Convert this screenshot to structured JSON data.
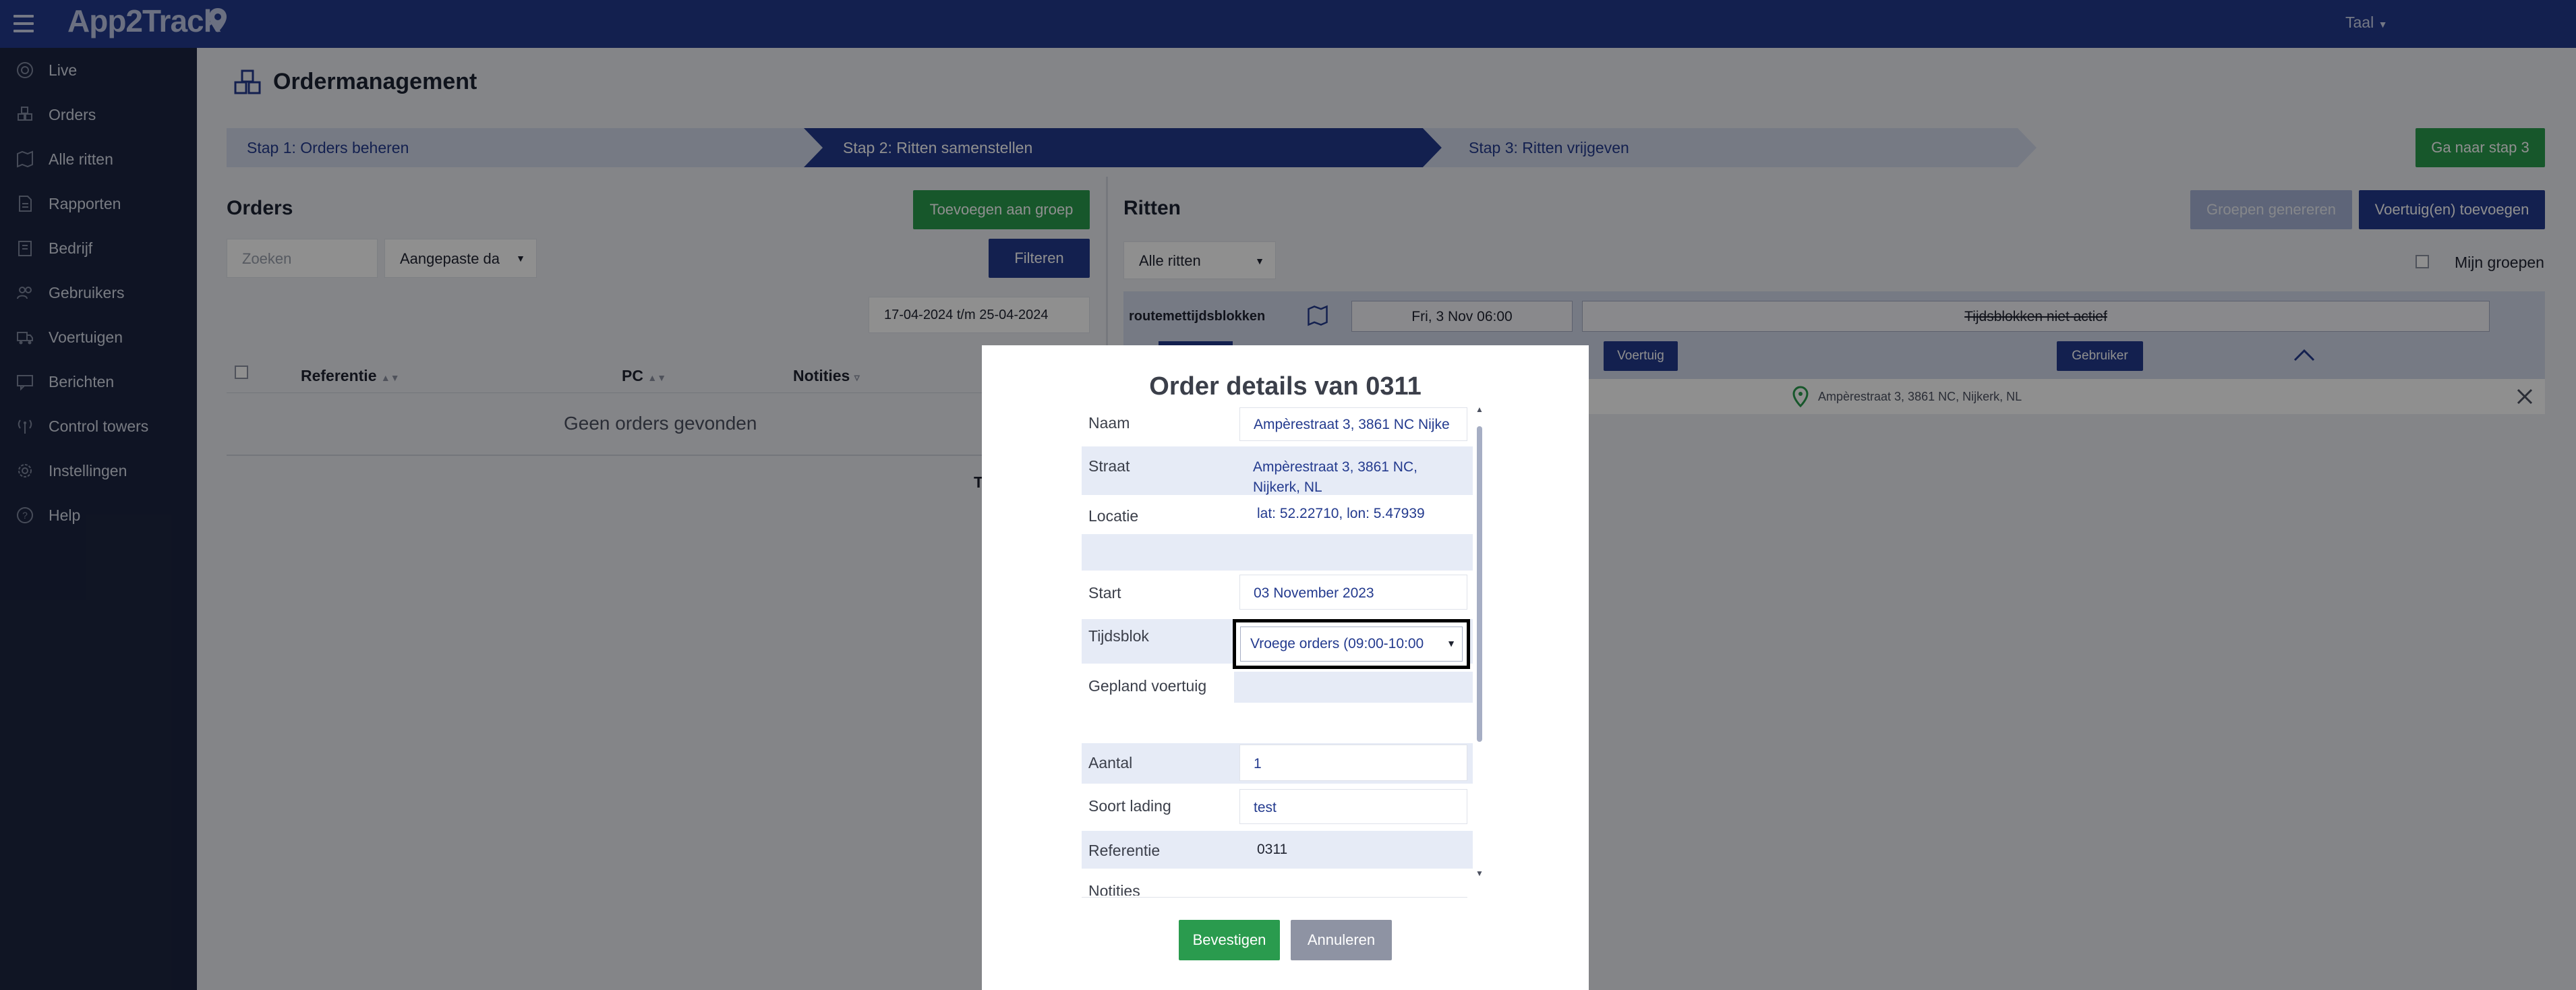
{
  "topbar": {
    "logo": "App2Track",
    "language_label": "Taal"
  },
  "sidebar": {
    "items": [
      {
        "label": "Live",
        "icon": "live-icon"
      },
      {
        "label": "Orders",
        "icon": "orders-icon"
      },
      {
        "label": "Alle ritten",
        "icon": "map-icon"
      },
      {
        "label": "Rapporten",
        "icon": "report-icon"
      },
      {
        "label": "Bedrijf",
        "icon": "building-icon"
      },
      {
        "label": "Gebruikers",
        "icon": "users-icon"
      },
      {
        "label": "Voertuigen",
        "icon": "truck-icon"
      },
      {
        "label": "Berichten",
        "icon": "message-icon"
      },
      {
        "label": "Control towers",
        "icon": "tower-icon"
      },
      {
        "label": "Instellingen",
        "icon": "gear-icon"
      },
      {
        "label": "Help",
        "icon": "help-icon"
      }
    ]
  },
  "page": {
    "title": "Ordermanagement"
  },
  "steps": [
    {
      "label": "Stap 1: Orders beheren",
      "active": false
    },
    {
      "label": "Stap 2: Ritten samenstellen",
      "active": true
    },
    {
      "label": "Stap 3: Ritten vrijgeven",
      "active": false
    }
  ],
  "step_button": "Ga naar stap 3",
  "orders": {
    "title": "Orders",
    "add_group_button": "Toevoegen aan groep",
    "search_placeholder": "Zoeken",
    "custom_select": "Aangepaste da",
    "filter_button": "Filteren",
    "date_range": "17-04-2024 t/m 25-04-2024",
    "columns": [
      "Referentie",
      "PC",
      "Notities"
    ],
    "empty_text": "Geen orders gevonden",
    "footer_letter": "T"
  },
  "ritten": {
    "title": "Ritten",
    "generate_button": "Groepen genereren",
    "add_vehicle_button": "Voertuig(en) toevoegen",
    "filter_select": "Alle ritten",
    "my_groups_label": "Mijn groepen",
    "route_name": "routemettijdsblokken",
    "route_date": "Fri, 3 Nov 06:00",
    "timeblocks_status": "Tijdsblokken niet actief",
    "vehicle_button": "Voertuig",
    "user_button": "Gebruiker",
    "stop_address": "Ampèrestraat 3, 3861 NC, Nijkerk, NL"
  },
  "dialog": {
    "title": "Order details van 0311",
    "fields": {
      "naam": {
        "label": "Naam",
        "value": "Ampèrestraat 3, 3861 NC Nijke"
      },
      "straat": {
        "label": "Straat",
        "line1": "Ampèrestraat 3, 3861 NC,",
        "line2": "Nijkerk, NL"
      },
      "locatie": {
        "label": "Locatie",
        "value": "lat: 52.22710, lon: 5.47939"
      },
      "start": {
        "label": "Start",
        "value": "03 November 2023"
      },
      "tijdsblok": {
        "label": "Tijdsblok",
        "value": "Vroege orders (09:00-10:00"
      },
      "gepland": {
        "label": "Gepland voertuig",
        "value": ""
      },
      "aantal": {
        "label": "Aantal",
        "value": "1"
      },
      "soort": {
        "label": "Soort lading",
        "value": "test"
      },
      "referentie": {
        "label": "Referentie",
        "value": "0311"
      },
      "notities": {
        "label": "Notities"
      }
    },
    "confirm_button": "Bevestigen",
    "cancel_button": "Annuleren"
  }
}
